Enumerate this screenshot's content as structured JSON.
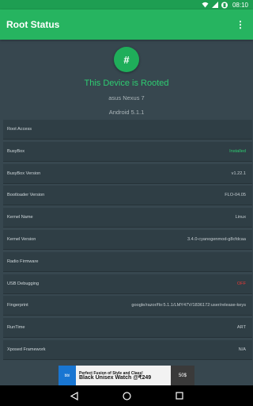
{
  "status_bar": {
    "time": "08:10",
    "icons": [
      "wifi-icon",
      "signal-icon",
      "battery-icon"
    ]
  },
  "app_bar": {
    "title": "Root Status",
    "menu_icon": "overflow-menu-icon"
  },
  "header": {
    "badge_symbol": "#",
    "status_text": "This Device is Rooted",
    "device_model": "asus Nexus 7",
    "android_version": "Android 5.1.1"
  },
  "rows": [
    {
      "label": "Root Access",
      "value": "",
      "status": ""
    },
    {
      "label": "BusyBox",
      "value": "Installed",
      "status": "ok"
    },
    {
      "label": "BusyBox Version",
      "value": "v1.22.1",
      "status": ""
    },
    {
      "label": "Bootloader Version",
      "value": "FLO-04.05",
      "status": ""
    },
    {
      "label": "Kernel  Name",
      "value": "Linux",
      "status": ""
    },
    {
      "label": "Kernel Version",
      "value": "3.4.0-cyanogenmod-g8cfdcaa",
      "status": ""
    },
    {
      "label": "Radio Firmware",
      "value": "",
      "status": ""
    },
    {
      "label": "USB Debugging",
      "value": "OFF",
      "status": "bad"
    },
    {
      "label": "Fingerprint",
      "value": "google/razor/flo:5.1.1/LMY47V/1836172:user/release-keys",
      "status": ""
    },
    {
      "label": "RunTime",
      "value": "ART",
      "status": ""
    },
    {
      "label": "Xposed Framework",
      "value": "N/A",
      "status": ""
    }
  ],
  "ad": {
    "brand": "bbi",
    "headline": "Perfect Fusion of Style and Class!",
    "offer": "Black Unisex Watch @₹249",
    "badge": "50$"
  },
  "colors": {
    "accent": "#26b460",
    "ok": "#2ecc71",
    "bad": "#e53935",
    "background": "#37474f",
    "row": "#2f3e45"
  }
}
